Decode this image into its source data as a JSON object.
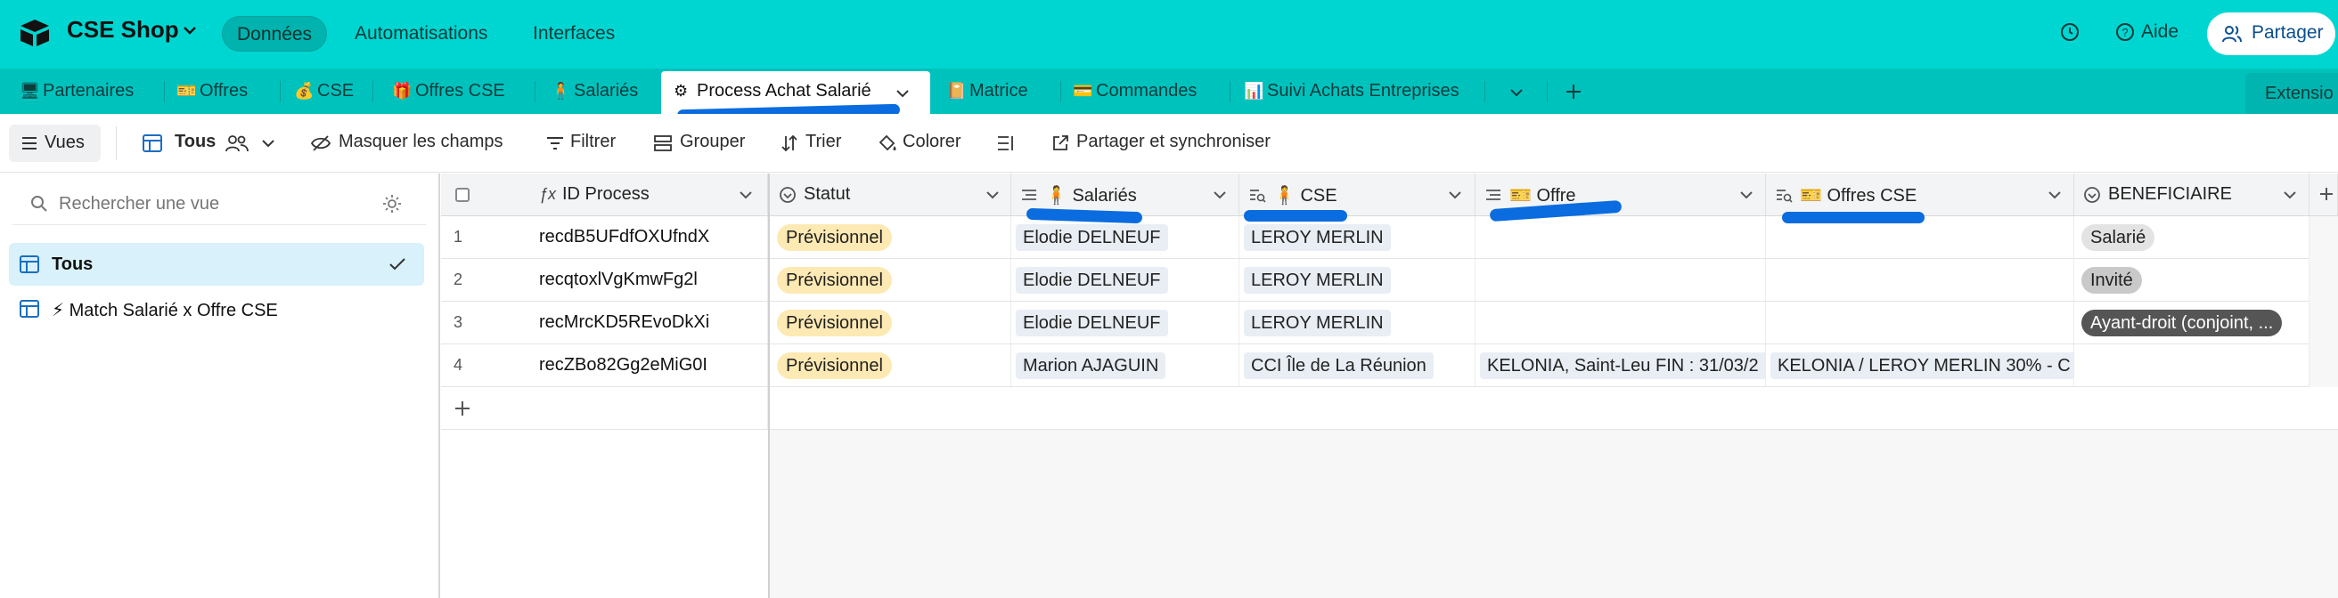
{
  "app": {
    "base_name": "CSE Shop",
    "nav": [
      "Données",
      "Automatisations",
      "Interfaces"
    ],
    "help_label": "Aide",
    "share_label": "Partager"
  },
  "tabs": [
    {
      "icon": "🖥",
      "label": "Partenaires"
    },
    {
      "icon": "🎫",
      "label": "Offres"
    },
    {
      "icon": "💰",
      "label": "CSE"
    },
    {
      "icon": "🎁",
      "label": "Offres CSE"
    },
    {
      "icon": "🧍",
      "label": "Salariés"
    },
    {
      "icon": "⚙",
      "label": "Process Achat Salarié"
    },
    {
      "icon": "📔",
      "label": "Matrice"
    },
    {
      "icon": "💳",
      "label": "Commandes"
    },
    {
      "icon": "📊",
      "label": "Suivi Achats Entreprises"
    }
  ],
  "extensions_label": "Extensio",
  "toolbar": {
    "views": "Vues",
    "current_view": "Tous",
    "hide_fields": "Masquer les champs",
    "filter": "Filtrer",
    "group": "Grouper",
    "sort": "Trier",
    "color": "Colorer",
    "share_sync": "Partager et synchroniser"
  },
  "sidebar": {
    "search_placeholder": "Rechercher une vue",
    "views": [
      "Tous",
      "⚡ Match Salarié x Offre CSE"
    ]
  },
  "columns": [
    {
      "label": "ID Process"
    },
    {
      "label": "Statut"
    },
    {
      "label": "🧍 Salariés"
    },
    {
      "label": "🧍 CSE"
    },
    {
      "label": "🎫 Offre"
    },
    {
      "label": "🎫 Offres CSE"
    },
    {
      "label": "BENEFICIAIRE"
    }
  ],
  "rows": [
    {
      "num": "1",
      "id": "recdB5UFdfOXUfndX",
      "statut": "Prévisionnel",
      "salarie": "Elodie DELNEUF",
      "cse": "LEROY MERLIN",
      "offre": "",
      "offres_cse": "",
      "beneficiaire": "Salarié"
    },
    {
      "num": "2",
      "id": "recqtoxlVgKmwFg2l",
      "statut": "Prévisionnel",
      "salarie": "Elodie DELNEUF",
      "cse": "LEROY MERLIN",
      "offre": "",
      "offres_cse": "",
      "beneficiaire": "Invité"
    },
    {
      "num": "3",
      "id": "recMrcKD5REvoDkXi",
      "statut": "Prévisionnel",
      "salarie": "Elodie DELNEUF",
      "cse": "LEROY MERLIN",
      "offre": "",
      "offres_cse": "",
      "beneficiaire": "Ayant-droit (conjoint, ..."
    },
    {
      "num": "4",
      "id": "recZBo82Gg2eMiG0I",
      "statut": "Prévisionnel",
      "salarie": "Marion AJAGUIN",
      "cse": "CCI Île de La Réunion",
      "offre": "KELONIA, Saint-Leu FIN : 31/03/2",
      "offres_cse": "KELONIA / LEROY MERLIN 30% - C",
      "beneficiaire": ""
    }
  ],
  "colors": {
    "brand": "#00d6d1",
    "tab_bar": "#00c2bd",
    "status_pill": "#fde9b3",
    "annotation": "#0a6cdf"
  }
}
